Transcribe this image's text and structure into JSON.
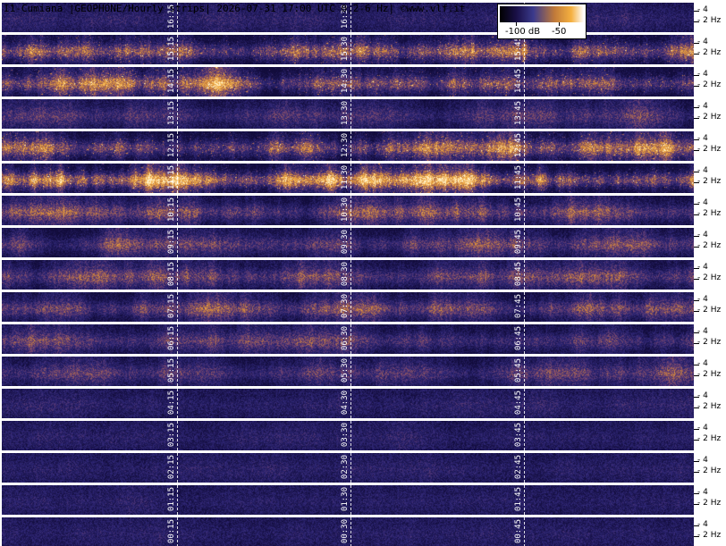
{
  "title": "I1-Cumiana |GEOPHONE/Hourly strips| 2026-07-31 17:00 UTC 0.2-6 Hz| ©www.vlf.it",
  "legend": {
    "labels": [
      "-100 dB",
      "-50"
    ]
  },
  "colors": {
    "low": "#241a5c",
    "mid": "#7a4a78",
    "high": "#f5b040",
    "divider": "#1b1b2a"
  },
  "chart_data": {
    "type": "heatmap",
    "title": "I1-Cumiana |GEOPHONE/Hourly strips| 2026-07-31 17:00 UTC 0.2-6 Hz| ©www.vlf.it",
    "x_unit": "time (UTC)",
    "y_axis_ticks": [
      "4",
      "2 Hz"
    ],
    "colorbar": {
      "labels": [
        "-100 dB",
        "-50"
      ]
    },
    "strips": [
      {
        "times": [
          "16:15",
          "16:30",
          ""
        ],
        "intensity": 0.15
      },
      {
        "times": [
          "15:15",
          "15:30",
          "15:45"
        ],
        "intensity": 0.75
      },
      {
        "times": [
          "14:15",
          "14:30",
          "14:45"
        ],
        "intensity": 0.7
      },
      {
        "times": [
          "13:15",
          "13:30",
          "13:45"
        ],
        "intensity": 0.35
      },
      {
        "times": [
          "12:15",
          "12:30",
          "12:45"
        ],
        "intensity": 0.7
      },
      {
        "times": [
          "11:15",
          "11:30",
          "11:45"
        ],
        "intensity": 0.95
      },
      {
        "times": [
          "10:15",
          "10:30",
          "10:45"
        ],
        "intensity": 0.55
      },
      {
        "times": [
          "09:15",
          "09:30",
          "09:45"
        ],
        "intensity": 0.5
      },
      {
        "times": [
          "08:15",
          "08:30",
          "08:45"
        ],
        "intensity": 0.5
      },
      {
        "times": [
          "07:15",
          "07:30",
          "07:45"
        ],
        "intensity": 0.55
      },
      {
        "times": [
          "06:15",
          "06:30",
          "06:45"
        ],
        "intensity": 0.45
      },
      {
        "times": [
          "05:15",
          "05:30",
          "05:45"
        ],
        "intensity": 0.4
      },
      {
        "times": [
          "04:15",
          "04:30",
          "04:45"
        ],
        "intensity": 0.15
      },
      {
        "times": [
          "03:15",
          "03:30",
          "03:45"
        ],
        "intensity": 0.12
      },
      {
        "times": [
          "02:15",
          "02:30",
          "02:45"
        ],
        "intensity": 0.12
      },
      {
        "times": [
          "01:15",
          "01:30",
          "01:45"
        ],
        "intensity": 0.1
      },
      {
        "times": [
          "00:15",
          "00:30",
          "00:45"
        ],
        "intensity": 0.1
      }
    ]
  }
}
